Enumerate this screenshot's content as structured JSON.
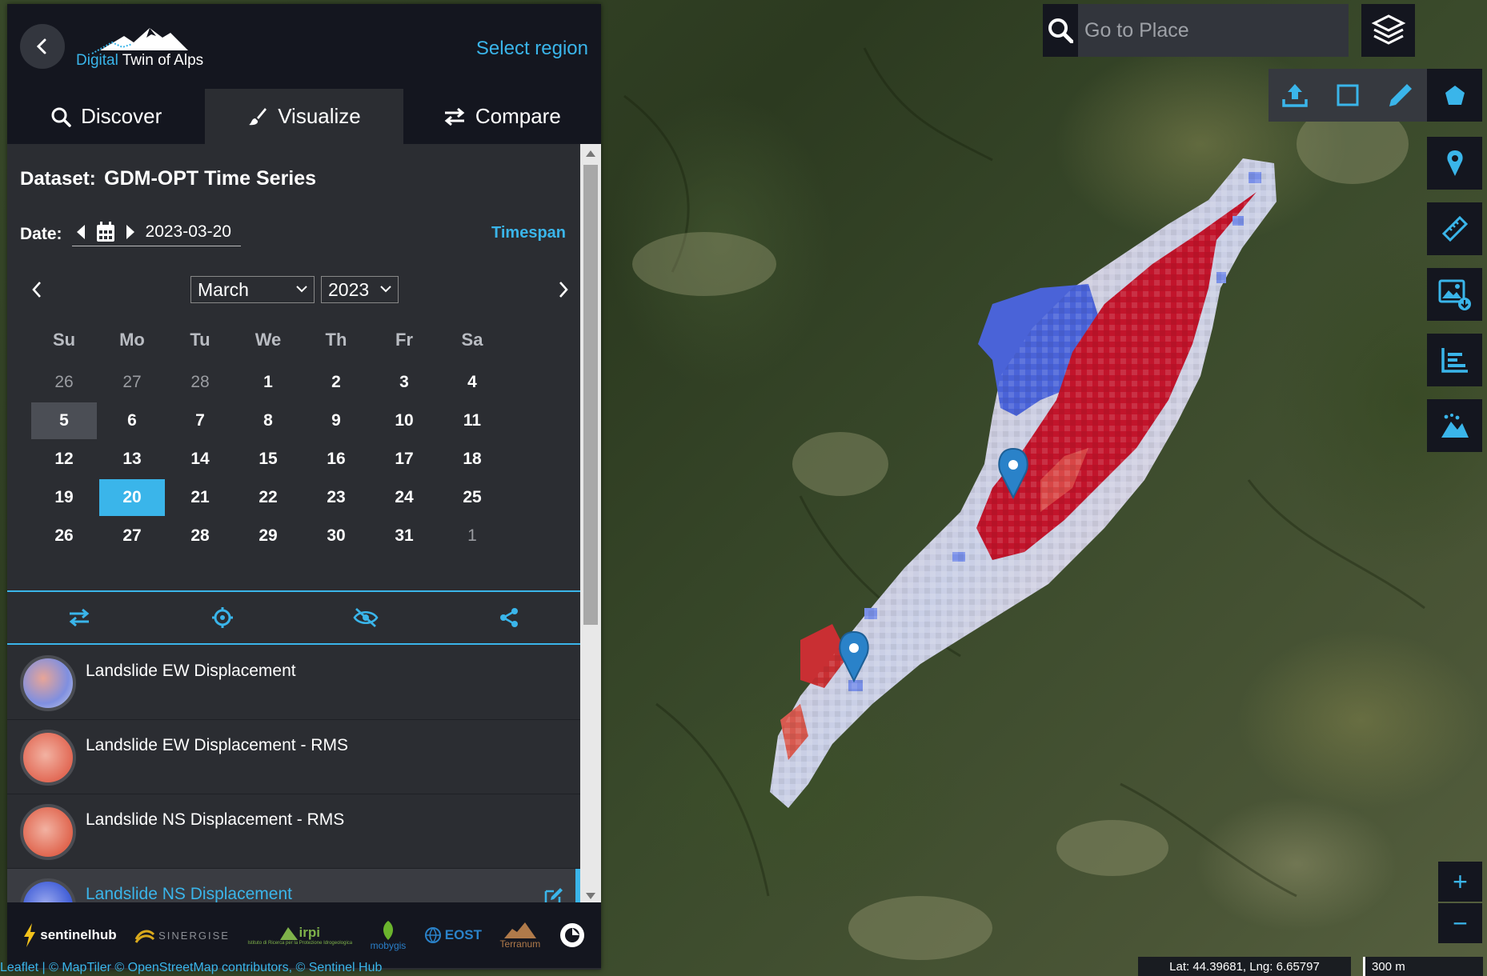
{
  "header": {
    "app_name_accent": "Digital",
    "app_name_rest": " Twin of Alps",
    "select_region": "Select region"
  },
  "tabs": [
    {
      "label": "Discover",
      "icon": "search-icon"
    },
    {
      "label": "Visualize",
      "icon": "brush-icon"
    },
    {
      "label": "Compare",
      "icon": "swap-icon"
    }
  ],
  "active_tab": "Visualize",
  "dataset": {
    "label": "Dataset:",
    "name": "GDM-OPT Time Series"
  },
  "date": {
    "label": "Date:",
    "value": "2023-03-20",
    "timespan": "Timespan"
  },
  "calendar": {
    "month": "March",
    "year": "2023",
    "weekdays": [
      "Su",
      "Mo",
      "Tu",
      "We",
      "Th",
      "Fr",
      "Sa"
    ],
    "weeks": [
      [
        "26",
        "27",
        "28",
        "1",
        "2",
        "3",
        "4"
      ],
      [
        "5",
        "6",
        "7",
        "8",
        "9",
        "10",
        "11"
      ],
      [
        "12",
        "13",
        "14",
        "15",
        "16",
        "17",
        "18"
      ],
      [
        "19",
        "20",
        "21",
        "22",
        "23",
        "24",
        "25"
      ],
      [
        "26",
        "27",
        "28",
        "29",
        "30",
        "31",
        "1"
      ]
    ],
    "selected_day": "20",
    "today_day": "5"
  },
  "toolbar_icons": [
    "swap-icon",
    "crosshair-icon",
    "eye-off-icon",
    "share-icon"
  ],
  "layers": [
    {
      "name": "Landslide EW Displacement",
      "active": false
    },
    {
      "name": "Landslide EW Displacement - RMS",
      "active": false
    },
    {
      "name": "Landslide NS Displacement - RMS",
      "active": false
    },
    {
      "name": "Landslide NS Displacement",
      "active": true
    }
  ],
  "footer_logos": {
    "sentinelhub": "sentinelhub",
    "sinergise": "SINERGISE",
    "irpi": "irpi",
    "irpi_sub": "Istituto di Ricerca per la Protezione Idrogeologica",
    "mobygis": "mobygis",
    "eost": "EOST",
    "terranum": "Terranum"
  },
  "attribution": "Leaflet | © MapTiler © OpenStreetMap contributors, © Sentinel Hub",
  "search": {
    "placeholder": "Go to Place"
  },
  "map": {
    "coordinates": "Lat: 44.39681, Lng: 6.65797",
    "scale": "300 m",
    "zoom_in": "+",
    "zoom_out": "−"
  },
  "colors": {
    "accent": "#3ab5ea",
    "panel": "#2b2d32",
    "dark": "#14161f"
  }
}
